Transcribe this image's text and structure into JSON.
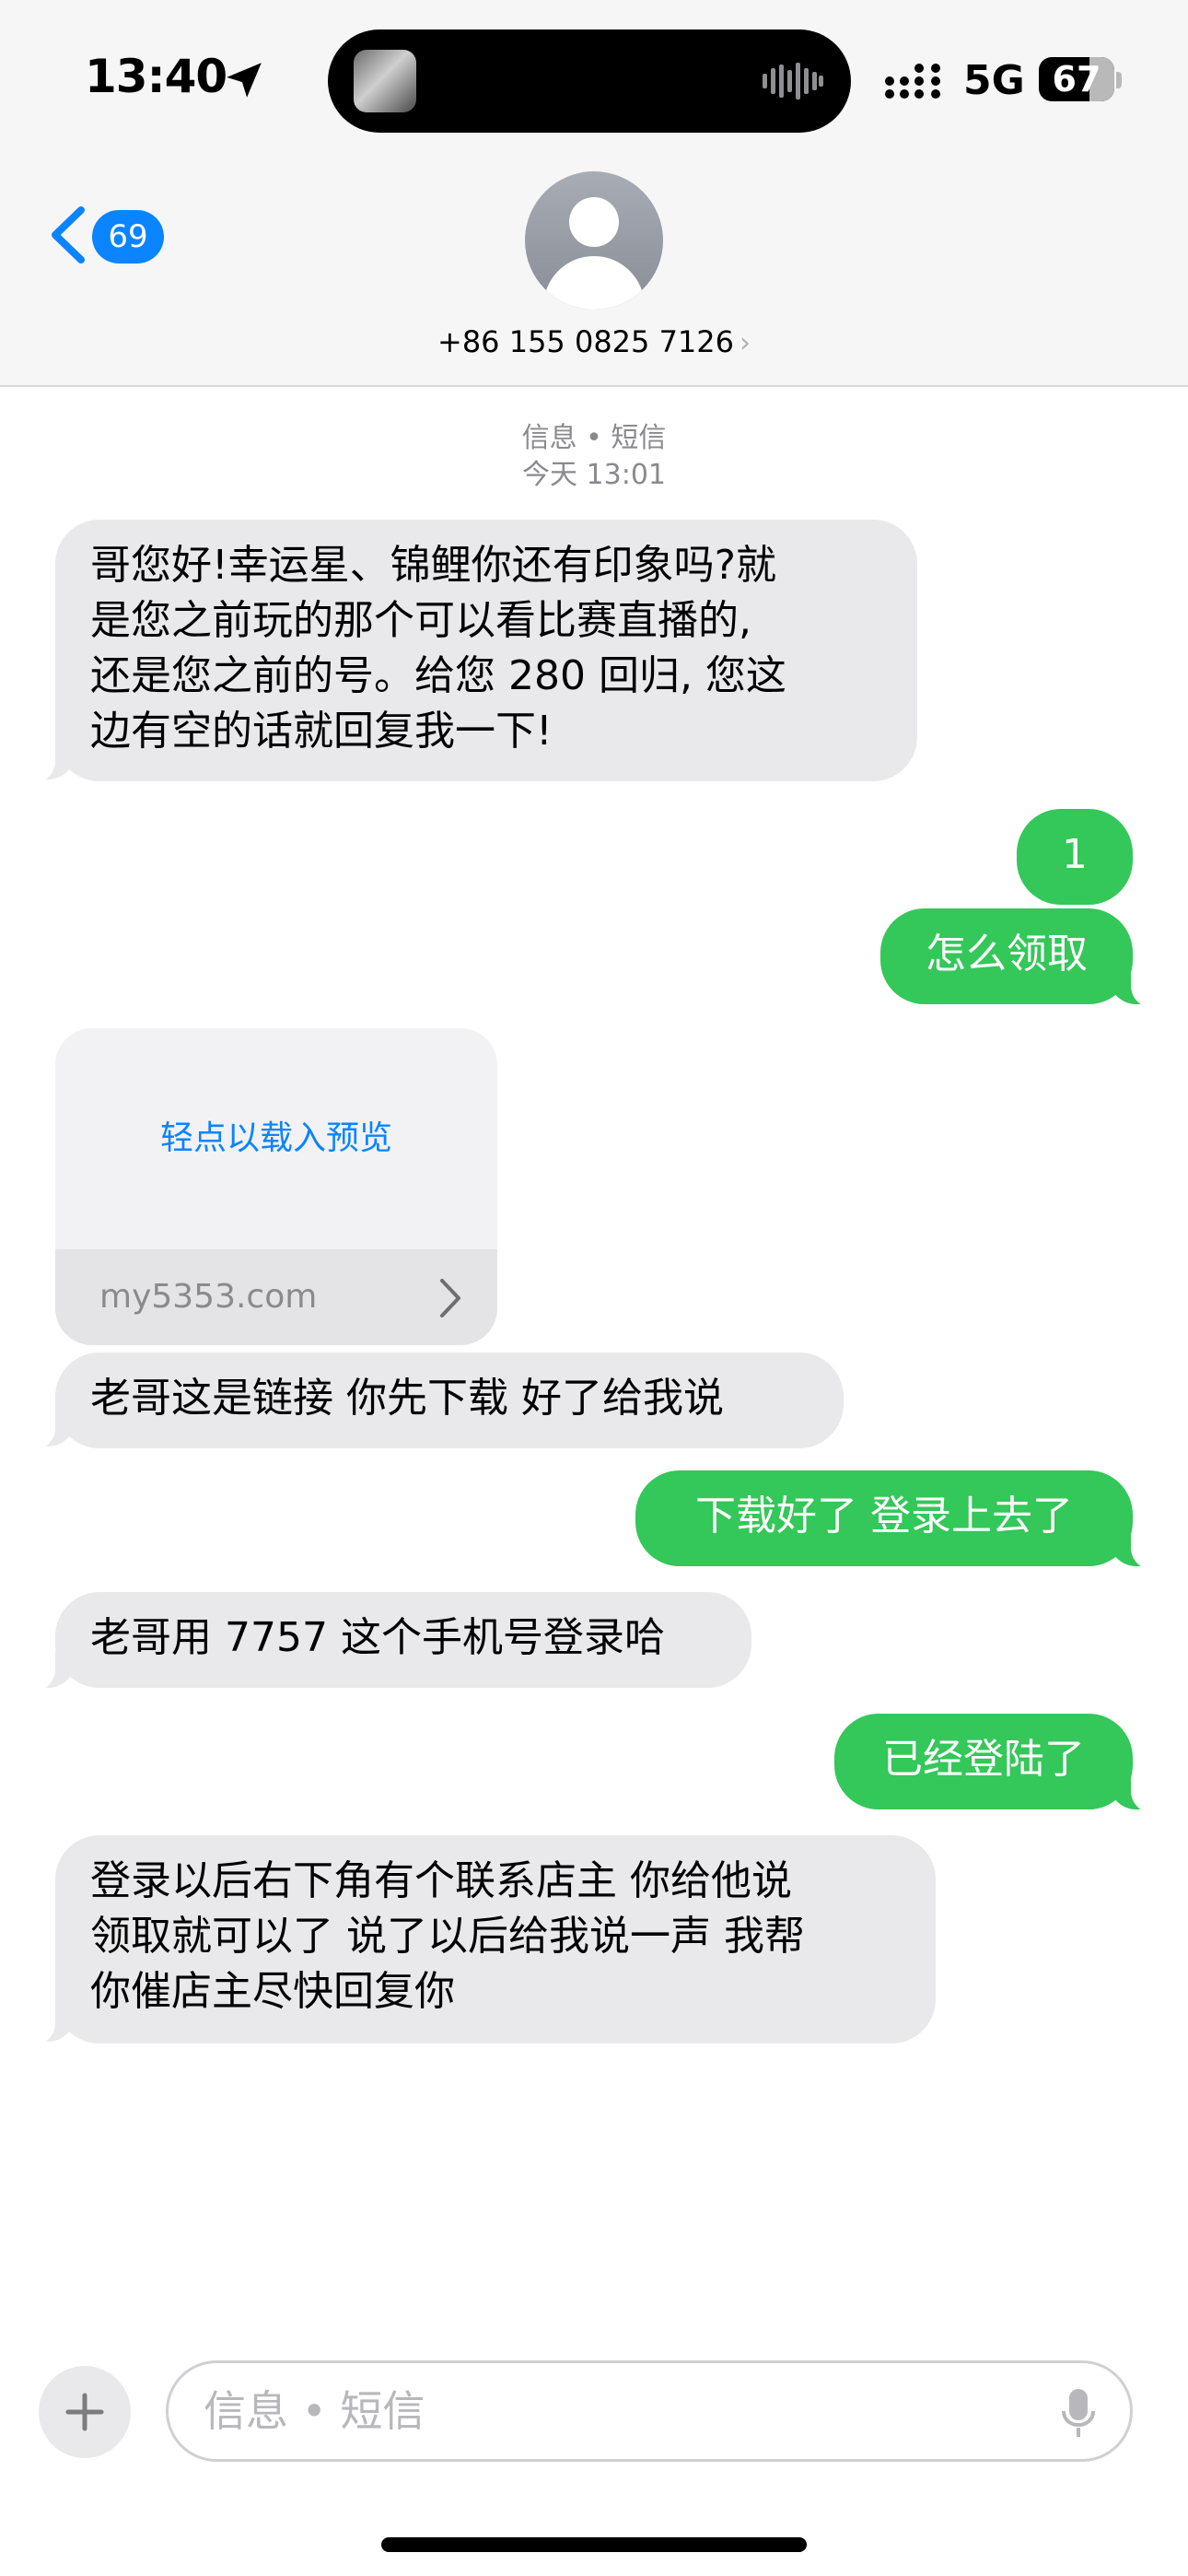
{
  "status_bar": {
    "time": "13:40",
    "network": "5G",
    "battery_level": "67",
    "battery_fraction": 0.67
  },
  "header": {
    "back_badge_count": "69",
    "contact_number": "+86 155 0825 7126",
    "contact_chevron": "›"
  },
  "thread": {
    "meta_line1": "信息 • 短信",
    "meta_line2": "今天 13:01",
    "messages": [
      {
        "dir": "in",
        "text": "哥您好!幸运星、锦鲤你还有印象吗?就\n是您之前玩的那个可以看比赛直播的,\n还是您之前的号。给您 280 回归, 您这\n边有空的话就回复我一下!"
      },
      {
        "dir": "out",
        "text": "1"
      },
      {
        "dir": "out",
        "text": "怎么领取"
      },
      {
        "dir": "in",
        "text": "老哥这是链接 你先下载 好了给我说"
      },
      {
        "dir": "out",
        "text": "下载好了 登录上去了"
      },
      {
        "dir": "in",
        "text": "老哥用 7757 这个手机号登录哈"
      },
      {
        "dir": "out",
        "text": "已经登陆了"
      },
      {
        "dir": "in",
        "text": "登录以后右下角有个联系店主 你给他说\n领取就可以了 说了以后给我说一声 我帮\n你催店主尽快回复你"
      }
    ],
    "link_preview": {
      "tap_label": "轻点以载入预览",
      "domain": "my5353.com"
    }
  },
  "composer": {
    "placeholder": "信息 • 短信"
  },
  "icons": {
    "back": "chevron-left-icon",
    "location": "location-arrow-icon",
    "signal": "cellular-signal-icon",
    "mic": "microphone-icon",
    "plus": "plus-icon"
  },
  "colors": {
    "incoming_bubble": "#e9e9eb",
    "outgoing_bubble": "#34c759",
    "accent": "#0a84ff"
  }
}
